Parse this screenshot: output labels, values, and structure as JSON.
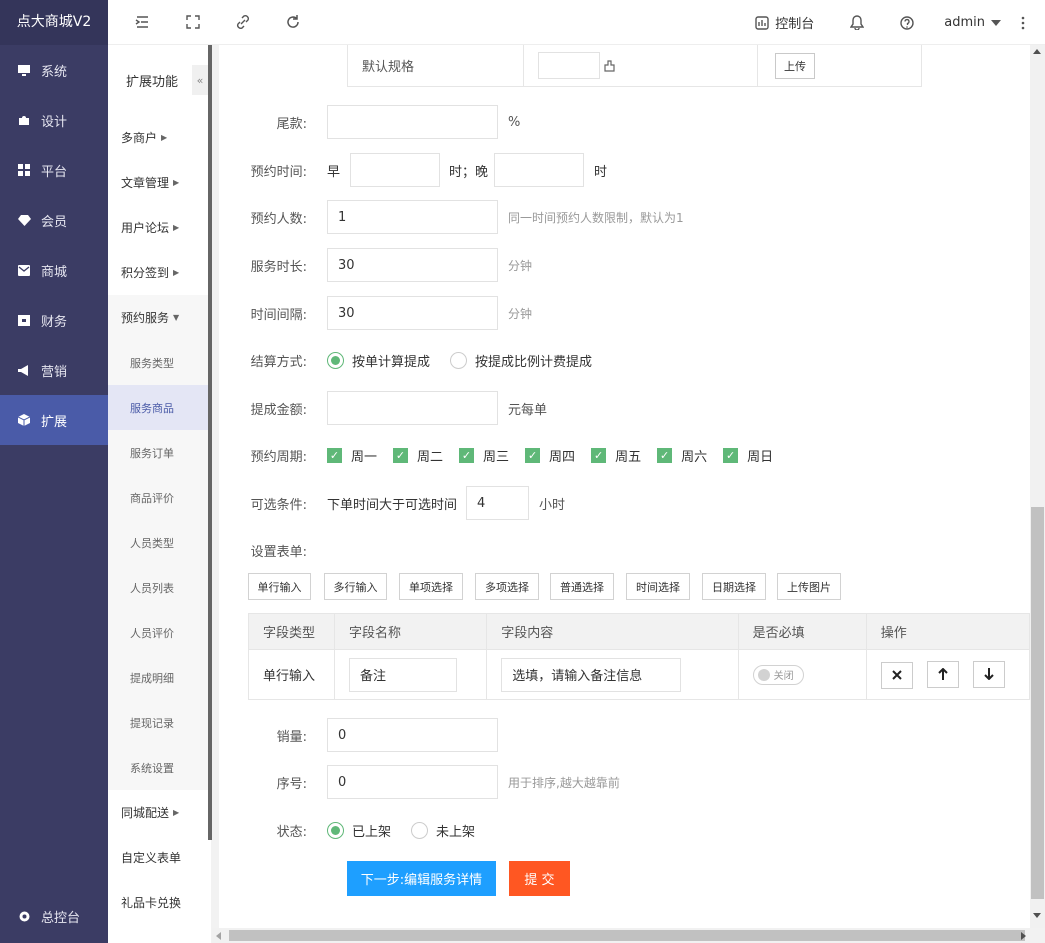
{
  "app": {
    "logo": "点大商城V2"
  },
  "nav": {
    "items": [
      "系统",
      "设计",
      "平台",
      "会员",
      "商城",
      "财务",
      "营销",
      "扩展"
    ],
    "bottom": "总控台"
  },
  "sub": {
    "header": "扩展功能",
    "collapse": "«",
    "groups": [
      "多商户",
      "文章管理",
      "用户论坛",
      "积分签到"
    ],
    "open_group": "预约服务",
    "children": [
      "服务类型",
      "服务商品",
      "服务订单",
      "商品评价",
      "人员类型",
      "人员列表",
      "人员评价",
      "提成明细",
      "提现记录",
      "系统设置"
    ],
    "after": [
      "同城配送",
      "自定义表单",
      "礼品卡兑换"
    ]
  },
  "top": {
    "console": "控制台",
    "user": "admin"
  },
  "spec": {
    "label": "默认规格",
    "upload": "上传"
  },
  "form": {
    "balance_label": "尾款:",
    "balance_unit": "%",
    "time_label": "预约时间:",
    "time_early": "早",
    "time_mid": "时；晚",
    "time_end": "时",
    "people_label": "预约人数:",
    "people_value": "1",
    "people_hint": "同一时间预约人数限制，默认为1",
    "duration_label": "服务时长:",
    "duration_value": "30",
    "duration_unit": "分钟",
    "interval_label": "时间间隔:",
    "interval_value": "30",
    "interval_unit": "分钟",
    "settle_label": "结算方式:",
    "settle_opt1": "按单计算提成",
    "settle_opt2": "按提成比例计费提成",
    "commission_label": "提成金额:",
    "commission_unit": "元每单",
    "cycle_label": "预约周期:",
    "days": [
      "周一",
      "周二",
      "周三",
      "周四",
      "周五",
      "周六",
      "周日"
    ],
    "cond_label": "可选条件:",
    "cond_text": "下单时间大于可选时间",
    "cond_value": "4",
    "cond_unit": "小时",
    "formset_label": "设置表单:",
    "field_buttons": [
      "单行输入",
      "多行输入",
      "单项选择",
      "多项选择",
      "普通选择",
      "时间选择",
      "日期选择",
      "上传图片"
    ],
    "table_headers": [
      "字段类型",
      "字段名称",
      "字段内容",
      "是否必填",
      "操作"
    ],
    "row": {
      "type": "单行输入",
      "name": "备注",
      "content": "选填，请输入备注信息",
      "required": "关闭"
    },
    "sales_label": "销量:",
    "sales_value": "0",
    "order_label": "序号:",
    "order_value": "0",
    "order_hint": "用于排序,越大越靠前",
    "status_label": "状态:",
    "status_on": "已上架",
    "status_off": "未上架",
    "next_btn": "下一步:编辑服务详情",
    "submit_btn": "提 交"
  },
  "colors": {
    "nav_bg": "#3b3c64",
    "active": "#4a5ba8",
    "green": "#5fb878",
    "primary": "#1e9fff",
    "submit": "#ff5722"
  }
}
